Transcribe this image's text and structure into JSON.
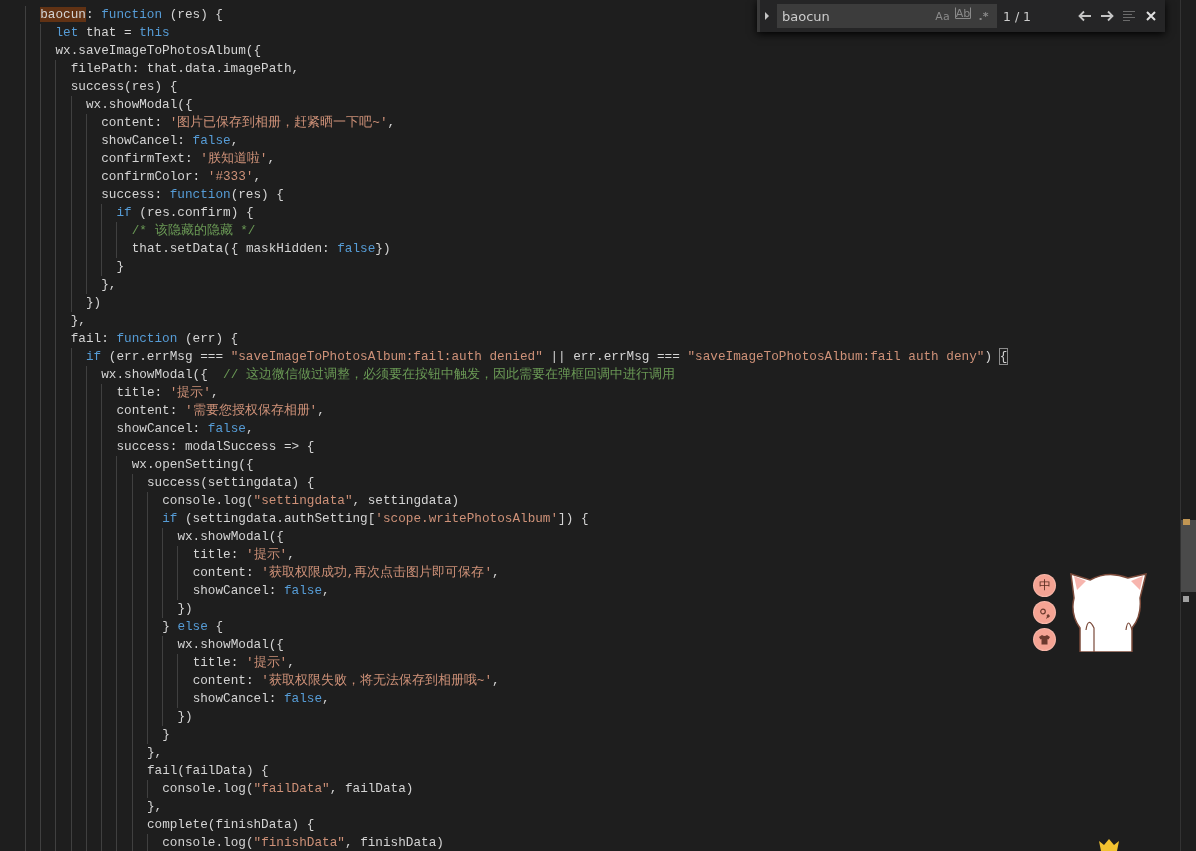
{
  "find_widget": {
    "replace_expanded": false,
    "value": "baocun",
    "count": "1 / 1",
    "options": [
      {
        "kind": "case",
        "label": "Aa",
        "on": false
      },
      {
        "kind": "word",
        "label": "Ab",
        "on": false
      },
      {
        "kind": "regex",
        "label": ".*",
        "on": false
      }
    ]
  },
  "editor": {
    "lines": [
      [
        {
          "kind": "match",
          "text": "  baocun"
        },
        {
          "kind": "plain",
          "text": ": "
        },
        {
          "kind": "keyword",
          "text": "function"
        },
        {
          "kind": "plain",
          "text": " (res) {"
        }
      ],
      [
        {
          "kind": "keyword",
          "text": "    let"
        },
        {
          "kind": "plain",
          "text": " that = "
        },
        {
          "kind": "keyword",
          "text": "this"
        }
      ],
      [
        {
          "kind": "plain",
          "text": "    wx.saveImageToPhotosAlbum({"
        }
      ],
      [
        {
          "kind": "plain",
          "text": "      filePath: that.data.imagePath,"
        }
      ],
      [
        {
          "kind": "plain",
          "text": "      success(res) {"
        }
      ],
      [
        {
          "kind": "plain",
          "text": "        wx.showModal({"
        }
      ],
      [
        {
          "kind": "plain",
          "text": "          content: "
        },
        {
          "kind": "string",
          "text": "'图片已保存到相册，赶紧晒一下吧~'"
        },
        {
          "kind": "plain",
          "text": ","
        }
      ],
      [
        {
          "kind": "plain",
          "text": "          showCancel: "
        },
        {
          "kind": "keyword",
          "text": "false"
        },
        {
          "kind": "plain",
          "text": ","
        }
      ],
      [
        {
          "kind": "plain",
          "text": "          confirmText: "
        },
        {
          "kind": "string",
          "text": "'朕知道啦'"
        },
        {
          "kind": "plain",
          "text": ","
        }
      ],
      [
        {
          "kind": "plain",
          "text": "          confirmColor: "
        },
        {
          "kind": "string",
          "text": "'#333'"
        },
        {
          "kind": "plain",
          "text": ","
        }
      ],
      [
        {
          "kind": "plain",
          "text": "          success: "
        },
        {
          "kind": "keyword",
          "text": "function"
        },
        {
          "kind": "plain",
          "text": "(res) {"
        }
      ],
      [
        {
          "kind": "keyword",
          "text": "            if"
        },
        {
          "kind": "plain",
          "text": " (res.confirm) {"
        }
      ],
      [
        {
          "kind": "comment",
          "text": "              /* 该隐藏的隐藏 */"
        }
      ],
      [
        {
          "kind": "plain",
          "text": "              that.setData({ maskHidden: "
        },
        {
          "kind": "keyword",
          "text": "false"
        },
        {
          "kind": "plain",
          "text": "})"
        }
      ],
      [
        {
          "kind": "plain",
          "text": "            }"
        }
      ],
      [
        {
          "kind": "plain",
          "text": "          },"
        }
      ],
      [
        {
          "kind": "plain",
          "text": "        })"
        }
      ],
      [
        {
          "kind": "plain",
          "text": "      },"
        }
      ],
      [
        {
          "kind": "plain",
          "text": "      fail: "
        },
        {
          "kind": "keyword",
          "text": "function"
        },
        {
          "kind": "plain",
          "text": " (err) {"
        }
      ],
      [
        {
          "kind": "keyword",
          "text": "        if"
        },
        {
          "kind": "plain",
          "text": " (err.errMsg === "
        },
        {
          "kind": "string",
          "text": "\"saveImageToPhotosAlbum:fail:auth denied\""
        },
        {
          "kind": "plain",
          "text": " || err.errMsg === "
        },
        {
          "kind": "string",
          "text": "\"saveImageToPhotosAlbum:fail auth deny\""
        },
        {
          "kind": "plain",
          "text": ") "
        },
        {
          "kind": "bracket",
          "text": "{"
        }
      ],
      [
        {
          "kind": "plain",
          "text": "          wx.showModal({  "
        },
        {
          "kind": "comment",
          "text": "// 这边微信做过调整，必须要在按钮中触发，因此需要在弹框回调中进行调用"
        }
      ],
      [
        {
          "kind": "plain",
          "text": "            title: "
        },
        {
          "kind": "string",
          "text": "'提示'"
        },
        {
          "kind": "plain",
          "text": ","
        }
      ],
      [
        {
          "kind": "plain",
          "text": "            content: "
        },
        {
          "kind": "string",
          "text": "'需要您授权保存相册'"
        },
        {
          "kind": "plain",
          "text": ","
        }
      ],
      [
        {
          "kind": "plain",
          "text": "            showCancel: "
        },
        {
          "kind": "keyword",
          "text": "false"
        },
        {
          "kind": "plain",
          "text": ","
        }
      ],
      [
        {
          "kind": "plain",
          "text": "            success: modalSuccess => {"
        }
      ],
      [
        {
          "kind": "plain",
          "text": "              wx.openSetting({"
        }
      ],
      [
        {
          "kind": "plain",
          "text": "                success(settingdata) {"
        }
      ],
      [
        {
          "kind": "plain",
          "text": "                  console.log("
        },
        {
          "kind": "string",
          "text": "\"settingdata\""
        },
        {
          "kind": "plain",
          "text": ", settingdata)"
        }
      ],
      [
        {
          "kind": "keyword",
          "text": "                  if"
        },
        {
          "kind": "plain",
          "text": " (settingdata.authSetting["
        },
        {
          "kind": "string",
          "text": "'scope.writePhotosAlbum'"
        },
        {
          "kind": "plain",
          "text": "]) {"
        }
      ],
      [
        {
          "kind": "plain",
          "text": "                    wx.showModal({"
        }
      ],
      [
        {
          "kind": "plain",
          "text": "                      title: "
        },
        {
          "kind": "string",
          "text": "'提示'"
        },
        {
          "kind": "plain",
          "text": ","
        }
      ],
      [
        {
          "kind": "plain",
          "text": "                      content: "
        },
        {
          "kind": "string",
          "text": "'获取权限成功,再次点击图片即可保存'"
        },
        {
          "kind": "plain",
          "text": ","
        }
      ],
      [
        {
          "kind": "plain",
          "text": "                      showCancel: "
        },
        {
          "kind": "keyword",
          "text": "false"
        },
        {
          "kind": "plain",
          "text": ","
        }
      ],
      [
        {
          "kind": "plain",
          "text": "                    })"
        }
      ],
      [
        {
          "kind": "plain",
          "text": "                  } "
        },
        {
          "kind": "keyword",
          "text": "else"
        },
        {
          "kind": "plain",
          "text": " {"
        }
      ],
      [
        {
          "kind": "plain",
          "text": "                    wx.showModal({"
        }
      ],
      [
        {
          "kind": "plain",
          "text": "                      title: "
        },
        {
          "kind": "string",
          "text": "'提示'"
        },
        {
          "kind": "plain",
          "text": ","
        }
      ],
      [
        {
          "kind": "plain",
          "text": "                      content: "
        },
        {
          "kind": "string",
          "text": "'获取权限失败，将无法保存到相册哦~'"
        },
        {
          "kind": "plain",
          "text": ","
        }
      ],
      [
        {
          "kind": "plain",
          "text": "                      showCancel: "
        },
        {
          "kind": "keyword",
          "text": "false"
        },
        {
          "kind": "plain",
          "text": ","
        }
      ],
      [
        {
          "kind": "plain",
          "text": "                    })"
        }
      ],
      [
        {
          "kind": "plain",
          "text": "                  }"
        }
      ],
      [
        {
          "kind": "plain",
          "text": "                },"
        }
      ],
      [
        {
          "kind": "plain",
          "text": "                fail(failData) {"
        }
      ],
      [
        {
          "kind": "plain",
          "text": "                  console.log("
        },
        {
          "kind": "string",
          "text": "\"failData\""
        },
        {
          "kind": "plain",
          "text": ", failData)"
        }
      ],
      [
        {
          "kind": "plain",
          "text": "                },"
        }
      ],
      [
        {
          "kind": "plain",
          "text": "                complete(finishData) {"
        }
      ],
      [
        {
          "kind": "plain",
          "text": "                  console.log("
        },
        {
          "kind": "string",
          "text": "\"finishData\""
        },
        {
          "kind": "plain",
          "text": ", finishData)"
        }
      ]
    ]
  },
  "ime_toolbar": {
    "mode": "中"
  }
}
